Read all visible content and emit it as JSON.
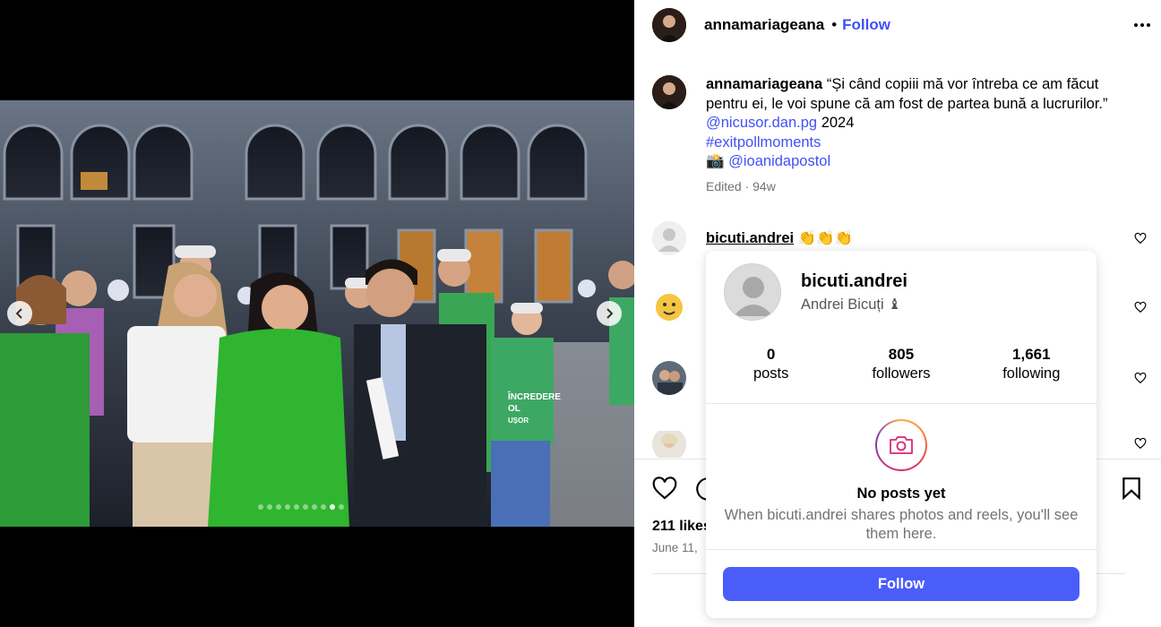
{
  "post": {
    "author": "annamariageana",
    "separator": "•",
    "follow_label": "Follow",
    "caption_text": "“Și când copiii mă vor întreba ce am făcut pentru ei, le voi spune că am fost de partea bună a lucrurilor.”",
    "mention_1": "@nicusor.dan.pg",
    "year": "2024",
    "hashtag": "#exitpollmoments",
    "camera_emoji": "📸",
    "mention_2": "@ioanidapostol",
    "meta": "Edited · 94w",
    "likes": "211 likes",
    "date": "June 11,"
  },
  "carousel": {
    "total": 10,
    "active_index": 8,
    "banner_text": "ÎNCREDERE",
    "banner_text_2": "OL",
    "banner_text_3": "UȘOR"
  },
  "comments": [
    {
      "user": "bicuti.andrei",
      "text": "👏👏👏"
    }
  ],
  "hover_card": {
    "username": "bicuti.andrei",
    "full_name": "Andrei Bicuți ♝",
    "stats": [
      {
        "value": "0",
        "label": "posts"
      },
      {
        "value": "805",
        "label": "followers"
      },
      {
        "value": "1,661",
        "label": "following"
      }
    ],
    "empty_title": "No posts yet",
    "empty_text": "When bicuti.andrei shares photos and reels, you'll see them here.",
    "follow_label": "Follow"
  },
  "colors": {
    "link": "#4150f7",
    "button": "#4a5df9",
    "muted": "#737373",
    "green_dress": "#2fb52f"
  }
}
